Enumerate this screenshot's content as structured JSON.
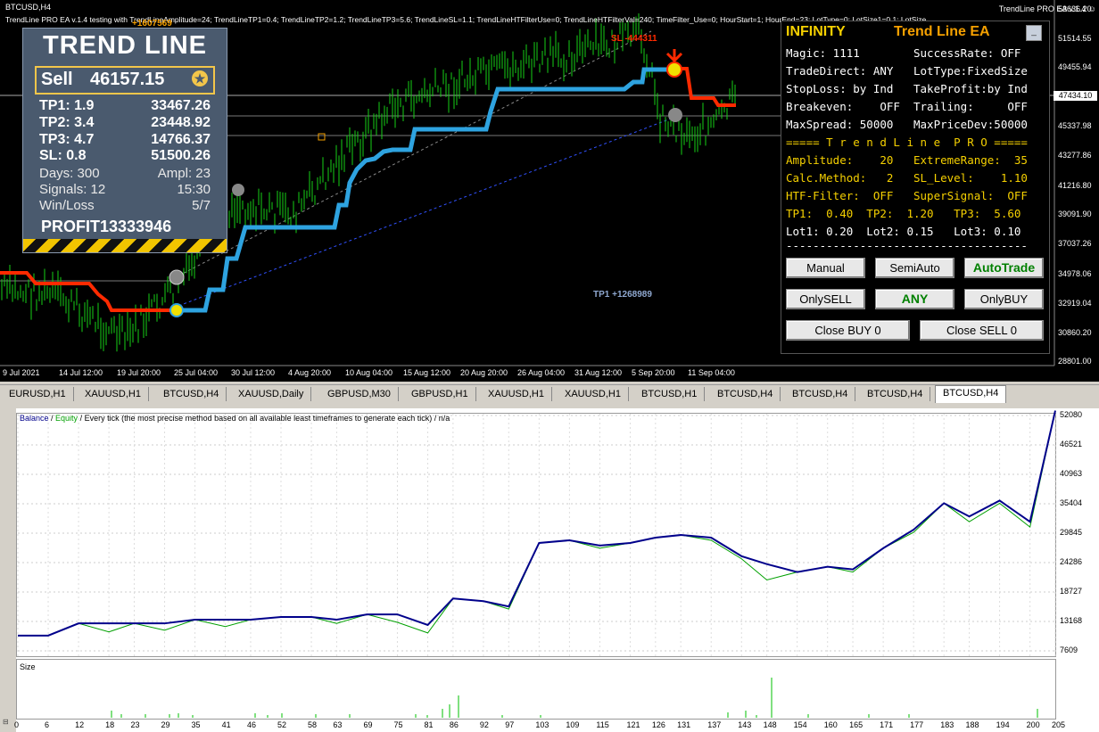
{
  "top_chart": {
    "symbol_label": "BTCUSD,H4",
    "params_line": "TrendLine PRO EA v.1.4 testing with TrendLineAmplitude=24; TrendLineTP1=0.4; TrendLineTP2=1.2; TrendLineTP3=5.6; TrendLineSL=1.1; TrendLineHTFilterUse=0; TrendLineHTFilterVal=240; TimeFilter_Use=0; HourStart=1; HourEnd=23; LotType=0; LotSize1=0.1; LotSize",
    "ea_label": "TrendLine PRO EA v.1.4",
    "y_labels": [
      "53636.20",
      "51514.55",
      "49455.94",
      "47434.10",
      "45337.98",
      "43277.86",
      "41216.80",
      "39091.90",
      "37037.26",
      "34978.06",
      "32919.04",
      "30860.20",
      "28801.00"
    ],
    "current_price": "47434.10",
    "x_labels": [
      "9 Jul 2021",
      "14 Jul 12:00",
      "19 Jul 20:00",
      "25 Jul 04:00",
      "30 Jul 12:00",
      "4 Aug 20:00",
      "10 Aug 04:00",
      "15 Aug 12:00",
      "20 Aug 20:00",
      "26 Aug 04:00",
      "31 Aug 12:00",
      "5 Sep 20:00",
      "11 Sep 04:00"
    ],
    "annotations": {
      "sl_label": "SL -444311",
      "tp1_label": "TP1 +1268989",
      "top_label": "+1607569"
    },
    "colors": {
      "blue_line": "#2ea3e0",
      "red_line": "#ff2a00",
      "candles": "#16d016"
    }
  },
  "trend_panel": {
    "title": "TREND LINE",
    "sell_label": "Sell",
    "sell_price": "46157.15",
    "star_icon": "star-icon",
    "tp_rows": [
      {
        "label": "TP1: 1.9",
        "value": "33467.26"
      },
      {
        "label": "TP2: 3.4",
        "value": "23448.92"
      },
      {
        "label": "TP3: 4.7",
        "value": "14766.37"
      },
      {
        "label": "SL: 0.8",
        "value": "51500.26"
      }
    ],
    "stats": [
      {
        "left": "Days: 300",
        "right": "Ampl: 23"
      },
      {
        "left": "Signals: 12",
        "right": "15:30"
      },
      {
        "left": "Win/Loss",
        "right": "5/7"
      }
    ],
    "profit_label": "PROFIT",
    "profit_value": "13333946"
  },
  "infinity_panel": {
    "title_left": "INFINITY",
    "title_right": "Trend Line EA",
    "minimize_symbol": "_",
    "rows": [
      "Magic: 1111        SuccessRate: OFF",
      "TradeDirect: ANY   LotType:FixedSize",
      "StopLoss: by Ind   TakeProfit:by Ind",
      "Breakeven:    OFF  Trailing:     OFF",
      "MaxSpread: 50000   MaxPriceDev:50000"
    ],
    "separator_title": "===== T r e n d L i n e  P R O =====",
    "yellow_rows": [
      "Amplitude:    20   ExtremeRange:  35",
      "Calc.Method:   2   SL_Level:    1.10",
      "HTF-Filter:  OFF   SuperSignal:  OFF",
      "TP1:  0.40  TP2:  1.20   TP3:  5.60",
      "Lot1: 0.20  Lot2: 0.15   Lot3: 0.10"
    ],
    "dash_line": "------------------------------------",
    "buttons": {
      "manual": "Manual",
      "semiauto": "SemiAuto",
      "autotrade": "AutoTrade",
      "onlysell": "OnlySELL",
      "any": "ANY",
      "onlybuy": "OnlyBUY",
      "close_buy": "Close BUY 0",
      "close_sell": "Close SELL 0"
    }
  },
  "tabs": [
    "EURUSD,H1",
    "XAUUSD,H1",
    "BTCUSD,H4",
    "XAUUSD,Daily",
    "GBPUSD,M30",
    "GBPUSD,H1",
    "XAUUSD,H1",
    "XAUUSD,H1",
    "BTCUSD,H1",
    "BTCUSD,H4",
    "BTCUSD,H4",
    "BTCUSD,H4",
    "BTCUSD,H4"
  ],
  "active_tab_index": 12,
  "tester": {
    "legend_balance": "Balance",
    "legend_sep1": " / ",
    "legend_equity": "Equity",
    "legend_rest": " / Every tick (the most precise method based on all available least timeframes to generate each tick) / n/a",
    "size_label": "Size",
    "y_labels": [
      "52080",
      "46521",
      "40963",
      "35404",
      "29845",
      "24286",
      "18727",
      "13168",
      "7609"
    ],
    "x_labels": [
      "0",
      "6",
      "12",
      "18",
      "23",
      "29",
      "35",
      "41",
      "46",
      "52",
      "58",
      "63",
      "69",
      "75",
      "81",
      "86",
      "92",
      "97",
      "103",
      "109",
      "115",
      "121",
      "126",
      "131",
      "137",
      "143",
      "148",
      "154",
      "160",
      "165",
      "171",
      "177",
      "183",
      "188",
      "194",
      "200",
      "205"
    ],
    "colors": {
      "balance": "#00008b",
      "equity": "#00a000",
      "volume": "#00c000"
    }
  },
  "chart_data": {
    "type": "line",
    "title": "",
    "xlabel": "",
    "ylabel": "",
    "ylim": [
      7609,
      52080
    ],
    "x": [
      0,
      6,
      12,
      18,
      23,
      29,
      35,
      41,
      46,
      52,
      58,
      63,
      69,
      75,
      81,
      86,
      92,
      97,
      103,
      109,
      115,
      121,
      126,
      131,
      137,
      143,
      148,
      154,
      160,
      165,
      171,
      177,
      183,
      188,
      194,
      200,
      205
    ],
    "series": [
      {
        "name": "Balance",
        "values": [
          10500,
          10500,
          12800,
          12800,
          12800,
          12800,
          13500,
          13500,
          13500,
          14000,
          14000,
          13500,
          14500,
          14500,
          12500,
          17500,
          17000,
          16000,
          28000,
          28500,
          27500,
          28000,
          29000,
          29500,
          29000,
          25500,
          24000,
          22500,
          23500,
          23000,
          27000,
          30500,
          35500,
          33000,
          36000,
          32000,
          53000
        ]
      },
      {
        "name": "Equity",
        "values": [
          10500,
          10500,
          12800,
          11200,
          12800,
          11500,
          13500,
          12200,
          13500,
          14000,
          14000,
          12800,
          14500,
          13000,
          11000,
          17500,
          17000,
          15500,
          28000,
          28500,
          27000,
          28000,
          29000,
          29500,
          28500,
          25000,
          21000,
          22500,
          23500,
          22500,
          27000,
          30000,
          35500,
          32000,
          35500,
          31000,
          53000
        ]
      }
    ]
  }
}
